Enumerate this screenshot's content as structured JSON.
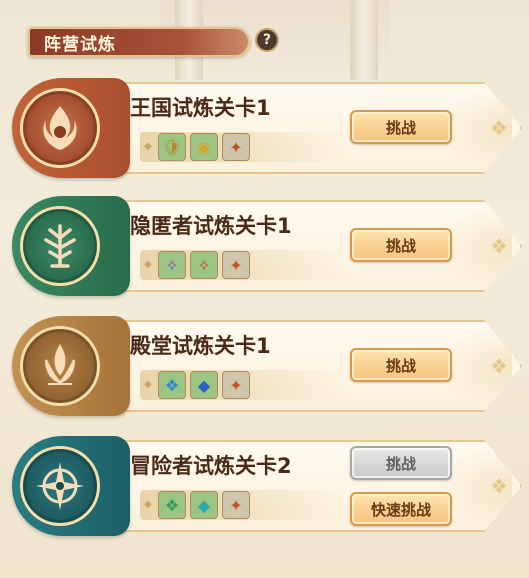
{
  "header": {
    "title": "阵营试炼",
    "help_glyph": "?"
  },
  "trials": [
    {
      "title": "王国试炼关卡1",
      "emblem": "phoenix-flame-icon",
      "color": "#b5572f",
      "rewards": [
        {
          "icon": "golden-shield-icon",
          "bg": "#8fbf7a",
          "glyph": "🛡"
        },
        {
          "icon": "gold-orb-icon",
          "bg": "#8fbf7a",
          "glyph": "◉"
        },
        {
          "icon": "hero-fragment-icon",
          "bg": "#c9c1a8",
          "glyph": "✦"
        }
      ],
      "buttons": [
        {
          "label": "挑战",
          "disabled": false
        }
      ]
    },
    {
      "title": "隐匿者试炼关卡1",
      "emblem": "tree-of-life-icon",
      "color": "#2f7c5a",
      "rewards": [
        {
          "icon": "purple-crystal-icon",
          "bg": "#8fbf7a",
          "glyph": "✧"
        },
        {
          "icon": "red-crystal-icon",
          "bg": "#8fbf7a",
          "glyph": "✧"
        },
        {
          "icon": "hero-fragment-icon",
          "bg": "#c9c1a8",
          "glyph": "✦"
        }
      ],
      "buttons": [
        {
          "label": "挑战",
          "disabled": false
        }
      ]
    },
    {
      "title": "殿堂试炼关卡1",
      "emblem": "lotus-flame-icon",
      "color": "#a97a3e",
      "rewards": [
        {
          "icon": "blue-relic-icon",
          "bg": "#8fbf7a",
          "glyph": "❖"
        },
        {
          "icon": "blue-gem-icon",
          "bg": "#8fbf7a",
          "glyph": "◆"
        },
        {
          "icon": "hero-fragment-icon",
          "bg": "#c9c1a8",
          "glyph": "✦"
        }
      ],
      "buttons": [
        {
          "label": "挑战",
          "disabled": false
        }
      ]
    },
    {
      "title": "冒险者试炼关卡2",
      "emblem": "compass-star-icon",
      "color": "#1f6f75",
      "rewards": [
        {
          "icon": "green-relic-icon",
          "bg": "#8fbf7a",
          "glyph": "❖"
        },
        {
          "icon": "cyan-gem-icon",
          "bg": "#8fbf7a",
          "glyph": "◆"
        },
        {
          "icon": "hero-fragment-icon",
          "bg": "#c9c1a8",
          "glyph": "✦"
        }
      ],
      "buttons": [
        {
          "label": "挑战",
          "disabled": true
        },
        {
          "label": "快速挑战",
          "disabled": false
        }
      ]
    }
  ]
}
